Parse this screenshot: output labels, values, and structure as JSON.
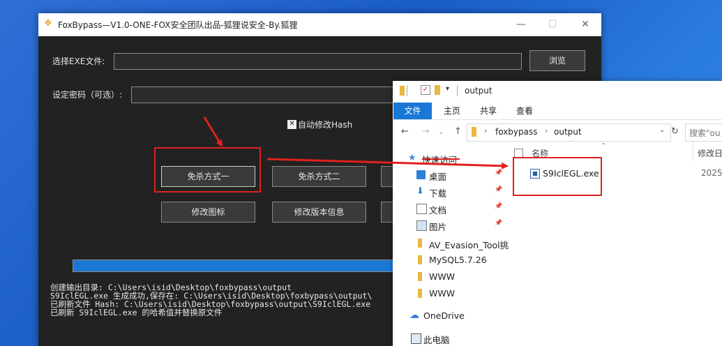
{
  "app": {
    "title": "FoxBypass—V1.0-ONE-FOX安全团队出品-狐狸说安全-By.狐狸",
    "exe_label": "选择EXE文件:",
    "exe_value": "",
    "browse_label": "浏览",
    "password_label": "设定密码（可选）:",
    "password_value": "",
    "auto_hash_checked": true,
    "auto_hash_label": "自动修改Hash",
    "buttons": {
      "method1": "免杀方式一",
      "method2": "免杀方式二",
      "modify_icon": "修改图标",
      "modify_version": "修改版本信息"
    },
    "progress_fraction": 1.0,
    "log_lines": [
      "创建输出目录: C:\\Users\\isid\\Desktop\\foxbypass\\output",
      "S9IclEGL.exe 生成成功,保存在: C:\\Users\\isid\\Desktop\\foxbypass\\output\\",
      "已刷新文件 Hash: C:\\Users\\isid\\Desktop\\foxbypass\\output\\S9IclEGL.exe",
      "已刷新 S9IclEGL.exe 的哈希值并替换原文件"
    ]
  },
  "explorer": {
    "title": "output",
    "ribbon_tabs": [
      "文件",
      "主页",
      "共享",
      "查看"
    ],
    "address_segments": [
      "foxbypass",
      "output"
    ],
    "search_placeholder": "搜索\"ou",
    "nav_items": [
      {
        "label": "快速访问",
        "icon": "star-icon",
        "pinned": false
      },
      {
        "label": "桌面",
        "icon": "desktop-icon",
        "pinned": true
      },
      {
        "label": "下载",
        "icon": "download-icon",
        "pinned": true
      },
      {
        "label": "文档",
        "icon": "document-icon",
        "pinned": true
      },
      {
        "label": "图片",
        "icon": "picture-icon",
        "pinned": true
      },
      {
        "label": "AV_Evasion_Tool挑",
        "icon": "folder-icon",
        "pinned": false
      },
      {
        "label": "MySQL5.7.26",
        "icon": "folder-icon",
        "pinned": false
      },
      {
        "label": "WWW",
        "icon": "folder-icon",
        "pinned": false
      },
      {
        "label": "WWW",
        "icon": "folder-icon",
        "pinned": false
      },
      {
        "label": "OneDrive",
        "icon": "cloud-icon",
        "pinned": false
      },
      {
        "label": "此电脑",
        "icon": "computer-icon",
        "pinned": false
      }
    ],
    "columns": {
      "name": "名称",
      "date": "修改日"
    },
    "files": [
      {
        "name": "S9IclEGL.exe",
        "date": "2025"
      }
    ]
  },
  "colors": {
    "accent_blue": "#1978d7",
    "highlight_red": "#e02020",
    "app_background": "#222222"
  }
}
